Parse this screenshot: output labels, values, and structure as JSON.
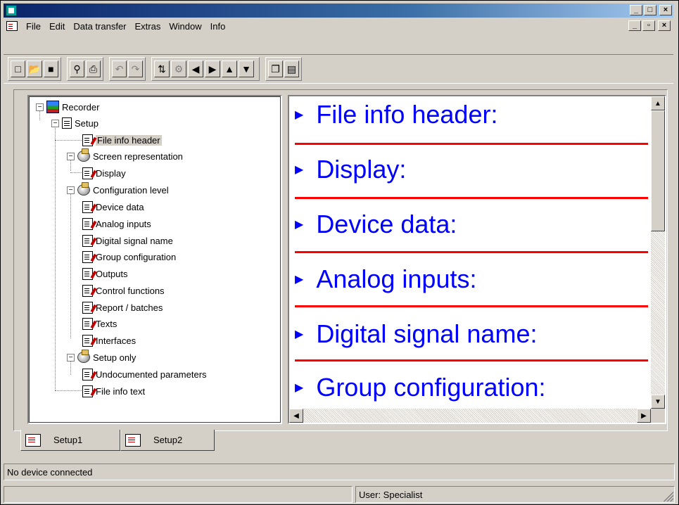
{
  "window": {
    "title": "",
    "controls": [
      "_",
      "□",
      "×"
    ]
  },
  "menu": [
    "File",
    "Edit",
    "Data transfer",
    "Extras",
    "Window",
    "Info"
  ],
  "mdi_controls": [
    "_",
    "▫",
    "×"
  ],
  "toolbar": {
    "groups": [
      [
        "new-icon",
        "open-icon",
        "save-icon"
      ],
      [
        "print-preview-icon",
        "print-icon"
      ],
      [
        "undo-icon",
        "redo-icon"
      ],
      [
        "transfer-icon",
        "transfer-disabled-icon",
        "prev-icon",
        "next-icon",
        "up-icon",
        "down-icon"
      ],
      [
        "window-cascade-icon",
        "window-tile-icon"
      ]
    ]
  },
  "tree": {
    "root": "Recorder",
    "setup": "Setup",
    "file_info_header": "File info header",
    "screen_representation": "Screen representation",
    "display": "Display",
    "configuration_level": "Configuration level",
    "config_items": [
      "Device data",
      "Analog inputs",
      "Digital signal name",
      "Group configuration",
      "Outputs",
      "Control functions",
      "Report / batches",
      "Texts",
      "Interfaces"
    ],
    "setup_only": "Setup only",
    "undocumented": "Undocumented parameters",
    "file_info_text": "File info text"
  },
  "view": {
    "sections": [
      "File info header:",
      "Display:",
      "Device data:",
      "Analog inputs:",
      "Digital signal name:",
      "Group configuration:"
    ]
  },
  "tabs": [
    "Setup1",
    "Setup2"
  ],
  "status": {
    "connection": "No device connected",
    "user": "User: Specialist"
  },
  "colors": {
    "titlebar": "#0a246a",
    "section_text": "#0000ff",
    "divider": "#ff0000",
    "face": "#d4d0c8"
  }
}
